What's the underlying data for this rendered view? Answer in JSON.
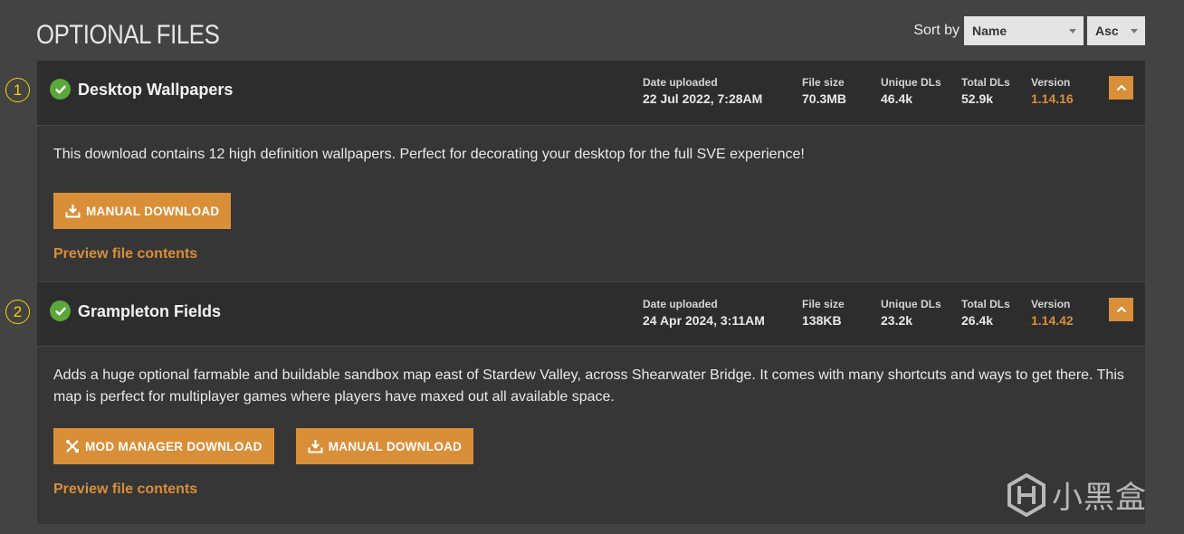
{
  "page": {
    "title": "OPTIONAL FILES"
  },
  "sort": {
    "label": "Sort by",
    "field": "Name",
    "direction": "Asc"
  },
  "stat_labels": {
    "date": "Date uploaded",
    "size": "File size",
    "unique": "Unique DLs",
    "total": "Total DLs",
    "version": "Version"
  },
  "files": [
    {
      "marker": "1",
      "name": "Desktop Wallpapers",
      "date": "22 Jul 2022, 7:28AM",
      "size": "70.3MB",
      "unique": "46.4k",
      "total": "52.9k",
      "version": "1.14.16",
      "description": "This download contains 12 high definition wallpapers. Perfect for decorating your desktop for the full SVE experience!",
      "manual_label": "MANUAL DOWNLOAD",
      "preview_label": "Preview file contents"
    },
    {
      "marker": "2",
      "name": "Grampleton Fields",
      "date": "24 Apr 2024, 3:11AM",
      "size": "138KB",
      "unique": "23.2k",
      "total": "26.4k",
      "version": "1.14.42",
      "description": "Adds a huge optional farmable and buildable sandbox map east of Stardew Valley, across Shearwater Bridge. It comes with many shortcuts and ways to get there. This map is perfect for multiplayer games where players have maxed out all available space.",
      "mod_manager_label": "MOD MANAGER DOWNLOAD",
      "manual_label": "MANUAL DOWNLOAD",
      "preview_label": "Preview file contents"
    }
  ],
  "watermark": {
    "text": "小黑盒"
  },
  "colors": {
    "accent": "#d98e38",
    "check": "#5aa83a",
    "marker": "#f0d400"
  }
}
